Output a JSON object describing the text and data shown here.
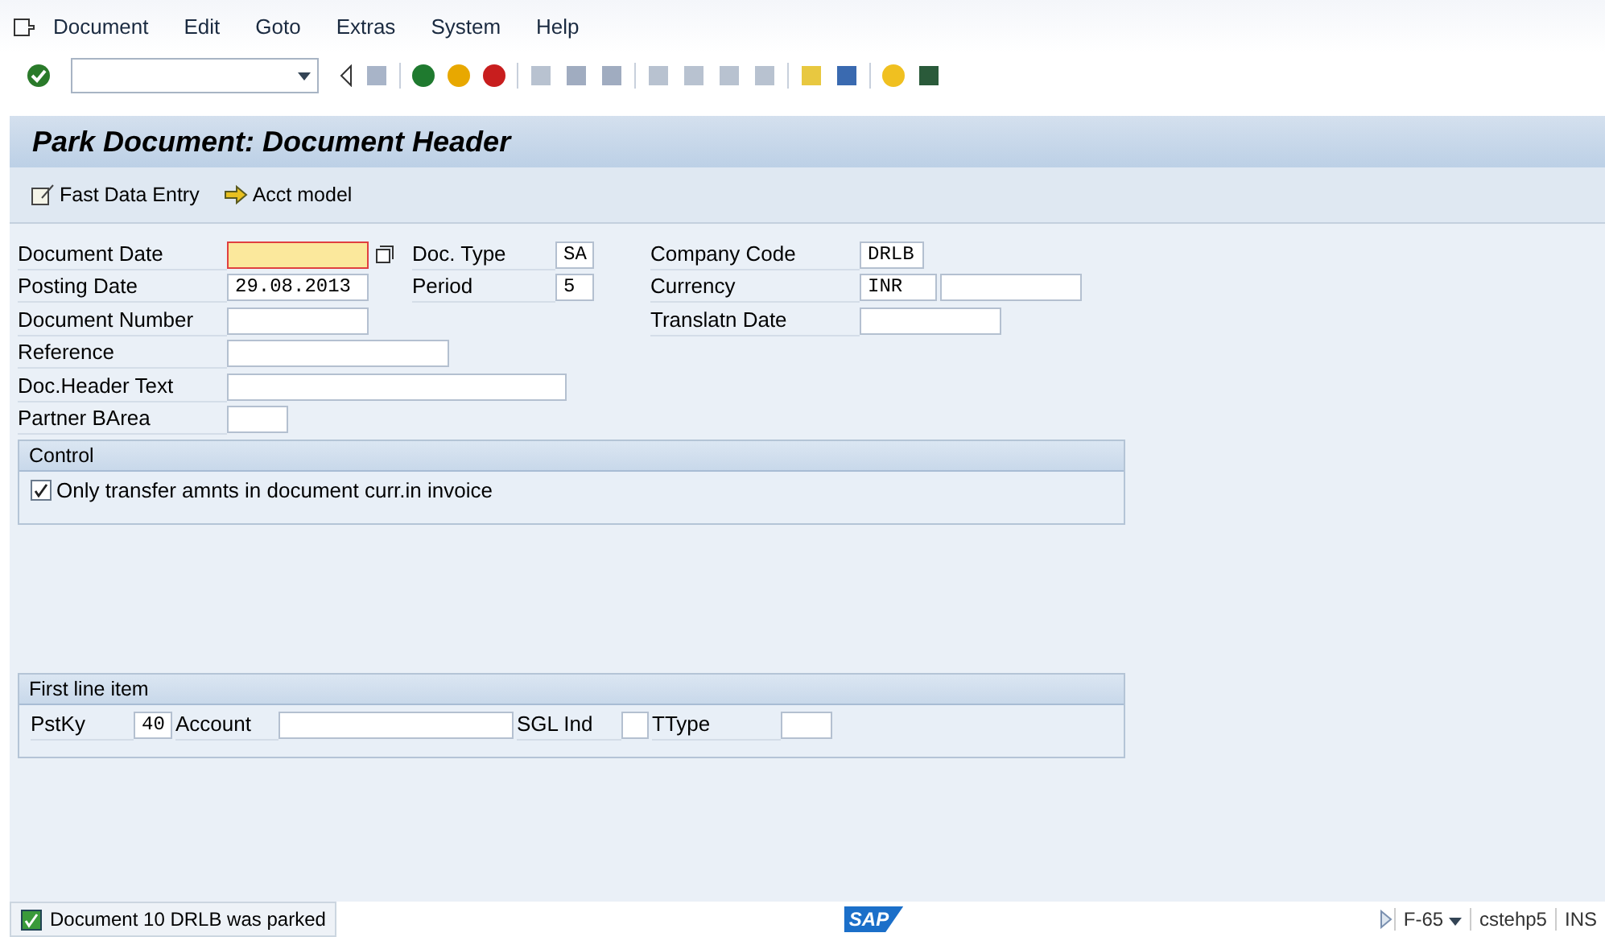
{
  "menu": [
    "Document",
    "Edit",
    "Goto",
    "Extras",
    "System",
    "Help"
  ],
  "title": "Park Document: Document Header",
  "app_toolbar": [
    {
      "label": "Fast Data Entry",
      "kind": "edit"
    },
    {
      "label": "Acct model",
      "kind": "model"
    }
  ],
  "header_rows": [
    [
      {
        "label": "Document Date",
        "focused": true
      },
      {
        "label": "Doc. Type",
        "value": "SA",
        "focused": false
      },
      {
        "label": "Company Code",
        "value": "DRLB",
        "focused": false
      }
    ],
    [
      {
        "label": "Posting Date",
        "value": "29.08.2013",
        "focused": false
      },
      {
        "label": "Period",
        "value": "5",
        "focused": false
      },
      {
        "label": "Currency",
        "value": "INR",
        "focused": false,
        "extra_field": true
      }
    ],
    [
      {
        "label": "Document Number",
        "focused": false
      },
      null,
      {
        "label": "Translatn Date",
        "focused": false
      }
    ],
    [
      {
        "label": "Reference",
        "focused": false
      }
    ],
    [
      {
        "label": "Doc.Header Text",
        "focused": false
      }
    ],
    [
      {
        "label": "Partner BArea",
        "focused": false
      }
    ]
  ],
  "control": {
    "title": "Control",
    "checkbox": {
      "label": "Only transfer amnts in document curr.in invoice",
      "checked": true
    }
  },
  "first_line_item": {
    "title": "First line item",
    "fields": [
      {
        "label": "PstKy",
        "value": "40"
      },
      {
        "label": "Account"
      },
      {
        "label": "SGL Ind"
      },
      {
        "label": "TType"
      }
    ]
  },
  "status_bar": {
    "message": "Document 10 DRLB was parked",
    "logo": "SAP",
    "transaction": "F-65",
    "server": "cstehp5",
    "mode": "INS"
  }
}
